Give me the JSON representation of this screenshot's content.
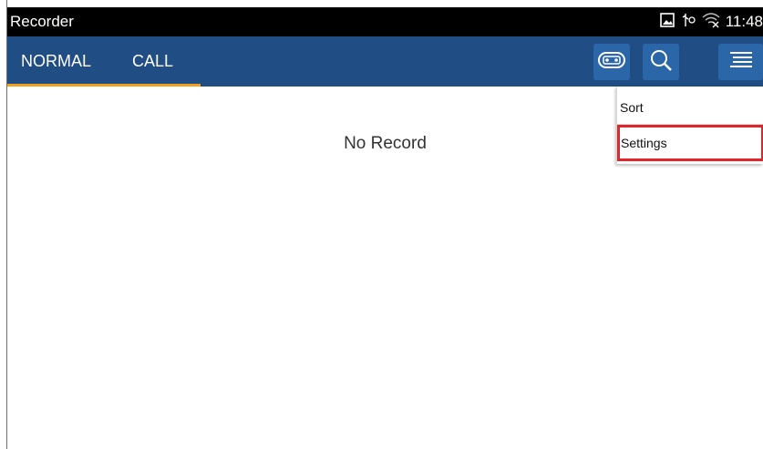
{
  "status_bar": {
    "app_title": "Recorder",
    "time": "11:48",
    "icons": [
      "image-icon",
      "usb-icon",
      "wifi-off-icon"
    ]
  },
  "app_bar": {
    "tabs": [
      {
        "label": "NORMAL",
        "selected": true
      },
      {
        "label": "CALL",
        "selected": false
      }
    ],
    "actions": [
      "tape-icon",
      "search-icon",
      "overflow-menu-icon"
    ],
    "accent_color": "#f0a21e",
    "bar_color": "#1f4d84"
  },
  "content": {
    "empty_message": "No Record"
  },
  "overflow_menu": {
    "items": [
      {
        "label": "Sort"
      },
      {
        "label": "Settings",
        "highlighted": true
      }
    ],
    "highlight_color": "#e0262b"
  }
}
